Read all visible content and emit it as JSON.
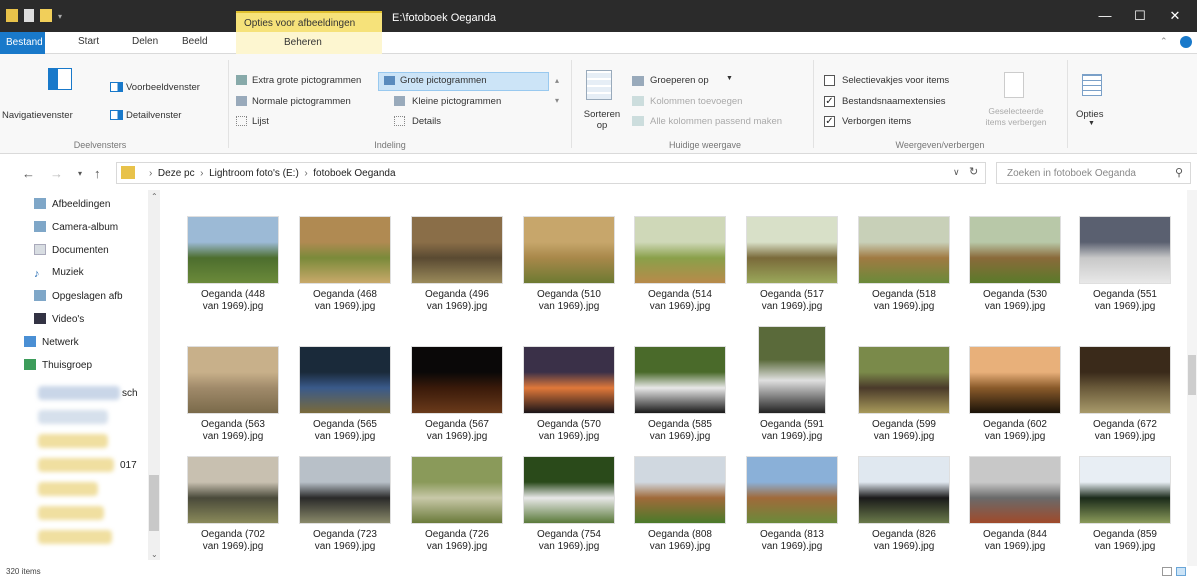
{
  "window": {
    "context_tab": "Opties voor afbeeldingen",
    "title": "E:\\fotoboek Oeganda",
    "minimize": "—",
    "maximize": "☐",
    "close": "✕"
  },
  "tabs": [
    "Bestand",
    "Start",
    "Delen",
    "Beeld",
    "Beheren"
  ],
  "ribbon": {
    "panes": {
      "nav_pane": "Navigatievenster",
      "preview": "Voorbeeldvenster",
      "details": "Detailvenster",
      "label": "Deelvensters"
    },
    "layout": {
      "items": [
        "Extra grote pictogrammen",
        "Grote pictogrammen",
        "Normale pictogrammen",
        "Kleine pictogrammen",
        "Lijst",
        "Details"
      ],
      "label": "Indeling"
    },
    "view": {
      "sort": "Sorteren op",
      "group_by": "Groeperen op",
      "add_columns": "Kolommen toevoegen",
      "fit_columns": "Alle kolommen passend maken",
      "label": "Huidige weergave"
    },
    "showhide": {
      "checkboxes": "Selectievakjes voor items",
      "extensions": "Bestandsnaamextensies",
      "hidden": "Verborgen items",
      "hide_selected": "Geselecteerde items verbergen",
      "options": "Opties",
      "label": "Weergeven/verbergen",
      "checks": [
        false,
        true,
        true
      ]
    }
  },
  "address": {
    "crumbs": [
      "Deze pc",
      "Lightroom foto's (E:)",
      "fotoboek Oeganda"
    ],
    "search_placeholder": "Zoeken in fotoboek Oeganda"
  },
  "navpane": {
    "items": [
      "Afbeeldingen",
      "Camera-album",
      "Documenten",
      "Muziek",
      "Opgeslagen afb",
      "Video's",
      "Netwerk",
      "Thuisgroep"
    ],
    "fragments": [
      "sch",
      "017"
    ]
  },
  "files": [
    {
      "n1": "Oeganda (448",
      "n2": "van 1969).jpg"
    },
    {
      "n1": "Oeganda (468",
      "n2": "van 1969).jpg"
    },
    {
      "n1": "Oeganda (496",
      "n2": "van 1969).jpg"
    },
    {
      "n1": "Oeganda (510",
      "n2": "van 1969).jpg"
    },
    {
      "n1": "Oeganda (514",
      "n2": "van 1969).jpg"
    },
    {
      "n1": "Oeganda (517",
      "n2": "van 1969).jpg"
    },
    {
      "n1": "Oeganda (518",
      "n2": "van 1969).jpg"
    },
    {
      "n1": "Oeganda (530",
      "n2": "van 1969).jpg"
    },
    {
      "n1": "Oeganda (551",
      "n2": "van 1969).jpg"
    },
    {
      "n1": "Oeganda (563",
      "n2": "van 1969).jpg"
    },
    {
      "n1": "Oeganda (565",
      "n2": "van 1969).jpg"
    },
    {
      "n1": "Oeganda (567",
      "n2": "van 1969).jpg"
    },
    {
      "n1": "Oeganda (570",
      "n2": "van 1969).jpg"
    },
    {
      "n1": "Oeganda (585",
      "n2": "van 1969).jpg"
    },
    {
      "n1": "Oeganda (591",
      "n2": "van 1969).jpg"
    },
    {
      "n1": "Oeganda (599",
      "n2": "van 1969).jpg"
    },
    {
      "n1": "Oeganda (602",
      "n2": "van 1969).jpg"
    },
    {
      "n1": "Oeganda (672",
      "n2": "van 1969).jpg"
    },
    {
      "n1": "Oeganda (702",
      "n2": "van 1969).jpg"
    },
    {
      "n1": "Oeganda (723",
      "n2": "van 1969).jpg"
    },
    {
      "n1": "Oeganda (726",
      "n2": "van 1969).jpg"
    },
    {
      "n1": "Oeganda (754",
      "n2": "van 1969).jpg"
    },
    {
      "n1": "Oeganda (808",
      "n2": "van 1969).jpg"
    },
    {
      "n1": "Oeganda (813",
      "n2": "van 1969).jpg"
    },
    {
      "n1": "Oeganda (826",
      "n2": "van 1969).jpg"
    },
    {
      "n1": "Oeganda (844",
      "n2": "van 1969).jpg"
    },
    {
      "n1": "Oeganda (859",
      "n2": "van 1969).jpg"
    }
  ],
  "status": "320 items",
  "colors": {
    "title_bg": "#2b2b2b",
    "file_tab": "#1979ca",
    "context_tab": "#f6e27a",
    "selection": "#cce4f7"
  }
}
